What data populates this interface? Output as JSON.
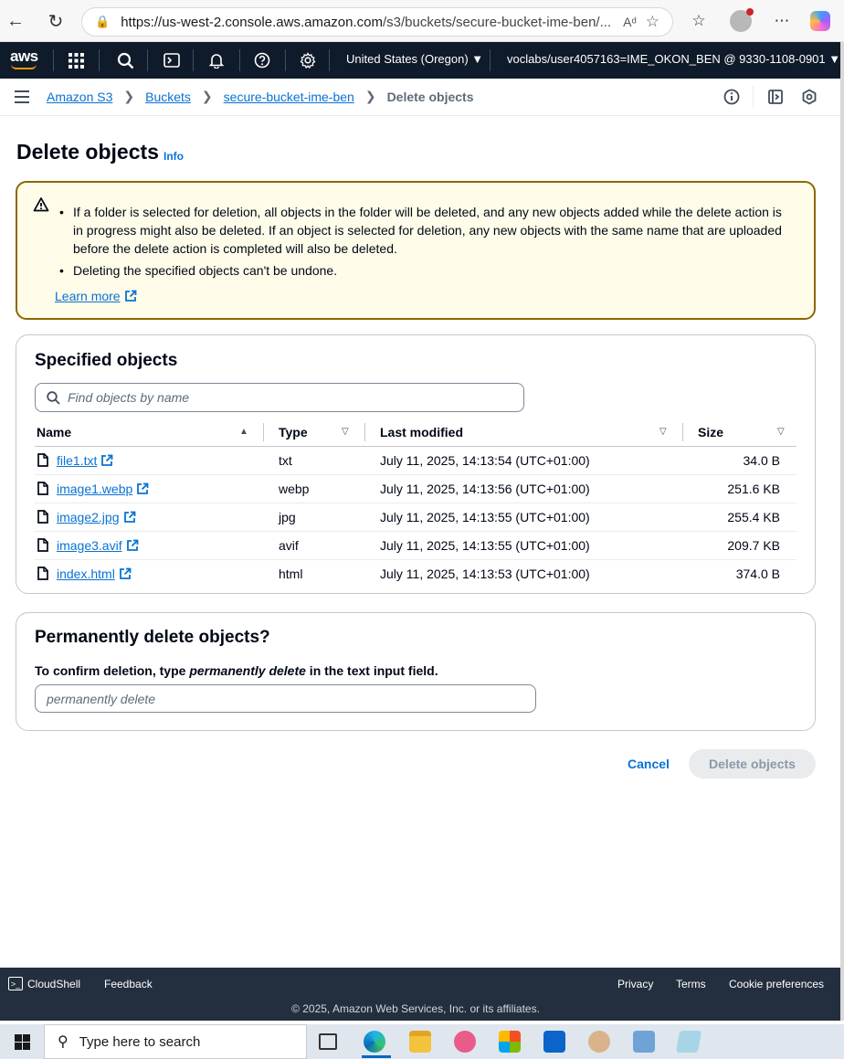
{
  "browser": {
    "url_host": "https://us-west-2.console.aws.amazon.com",
    "url_path": "/s3/buckets/secure-bucket-ime-ben/..."
  },
  "aws_nav": {
    "logo": "aws",
    "region": "United States (Oregon) ▼",
    "account": "voclabs/user4057163=IME_OKON_BEN @ 9330-1108-0901 ▼"
  },
  "breadcrumb": {
    "items": [
      "Amazon S3",
      "Buckets",
      "secure-bucket-ime-ben"
    ],
    "current": "Delete objects"
  },
  "page": {
    "title": "Delete objects",
    "info": "Info"
  },
  "warning": {
    "bullets": [
      "If a folder is selected for deletion, all objects in the folder will be deleted, and any new objects added while the delete action is in progress might also be deleted. If an object is selected for deletion, any new objects with the same name that are uploaded before the delete action is completed will also be deleted.",
      "Deleting the specified objects can't be undone."
    ],
    "learn_more": "Learn more"
  },
  "objects_panel": {
    "title": "Specified objects",
    "search_placeholder": "Find objects by name",
    "columns": [
      "Name",
      "Type",
      "Last modified",
      "Size"
    ],
    "rows": [
      {
        "name": "file1.txt",
        "type": "txt",
        "modified": "July 11, 2025, 14:13:54 (UTC+01:00)",
        "size": "34.0 B"
      },
      {
        "name": "image1.webp",
        "type": "webp",
        "modified": "July 11, 2025, 14:13:56 (UTC+01:00)",
        "size": "251.6 KB"
      },
      {
        "name": "image2.jpg",
        "type": "jpg",
        "modified": "July 11, 2025, 14:13:55 (UTC+01:00)",
        "size": "255.4 KB"
      },
      {
        "name": "image3.avif",
        "type": "avif",
        "modified": "July 11, 2025, 14:13:55 (UTC+01:00)",
        "size": "209.7 KB"
      },
      {
        "name": "index.html",
        "type": "html",
        "modified": "July 11, 2025, 14:13:53 (UTC+01:00)",
        "size": "374.0 B"
      }
    ]
  },
  "confirm_panel": {
    "title": "Permanently delete objects?",
    "label_prefix": "To confirm deletion, type ",
    "label_emphasis": "permanently delete",
    "label_suffix": " in the text input field.",
    "input_placeholder": "permanently delete"
  },
  "actions": {
    "cancel": "Cancel",
    "delete": "Delete objects"
  },
  "footer": {
    "cloudshell": "CloudShell",
    "feedback": "Feedback",
    "privacy": "Privacy",
    "terms": "Terms",
    "cookie": "Cookie preferences",
    "copyright": "© 2025, Amazon Web Services, Inc. or its affiliates."
  },
  "taskbar": {
    "search_placeholder": "Type here to search"
  },
  "colors": {
    "aws_nav_bg": "#0f1b2a",
    "link": "#0972d3",
    "warning_border": "#8d6605",
    "warning_bg": "#fffce9",
    "footer_bg": "#232f3e"
  }
}
